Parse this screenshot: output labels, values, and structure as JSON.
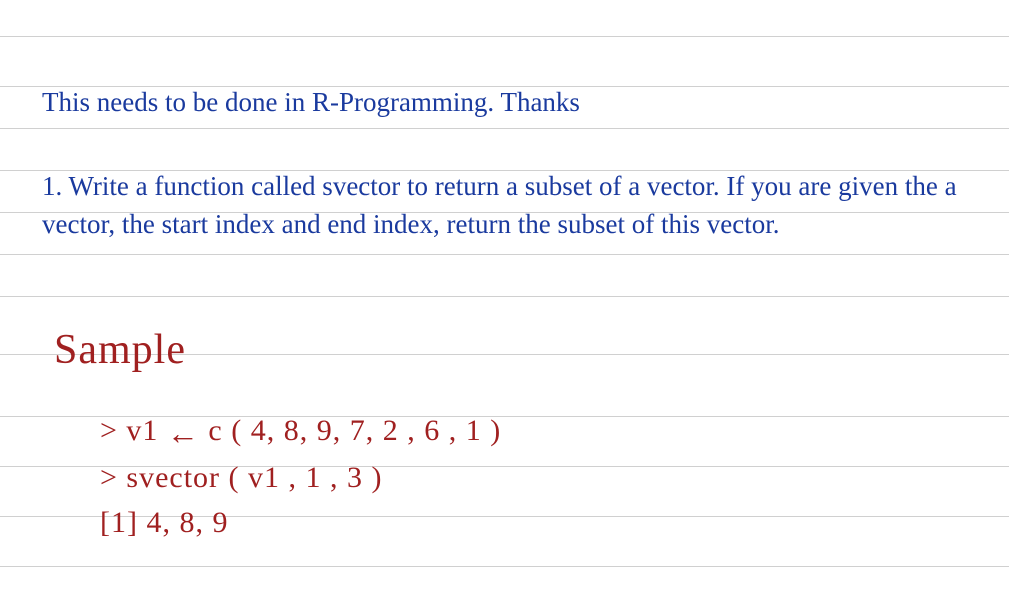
{
  "typed": {
    "intro": "This needs to be done in R-Programming. Thanks",
    "question": "1. Write a function called svector to return a subset of a vector. If you are given the a vector, the start index and end index, return the subset of this vector."
  },
  "handwritten": {
    "title": "Sample",
    "code_line1_prompt": ">",
    "code_line1_var": "v1",
    "code_line1_arrow": "←",
    "code_line1_call": "c ( 4, 8, 9, 7, 2 , 6 , 1 )",
    "code_line2": "> svector ( v1 , 1 , 3 )",
    "code_line3": "[1]  4, 8, 9"
  },
  "colors": {
    "ruled_line": "#d0d0d0",
    "typed_text": "#1a3a9e",
    "handwritten": "#a02020"
  },
  "line_positions": [
    36,
    86,
    128,
    170,
    212,
    254,
    296,
    354,
    416,
    466,
    516,
    566
  ]
}
